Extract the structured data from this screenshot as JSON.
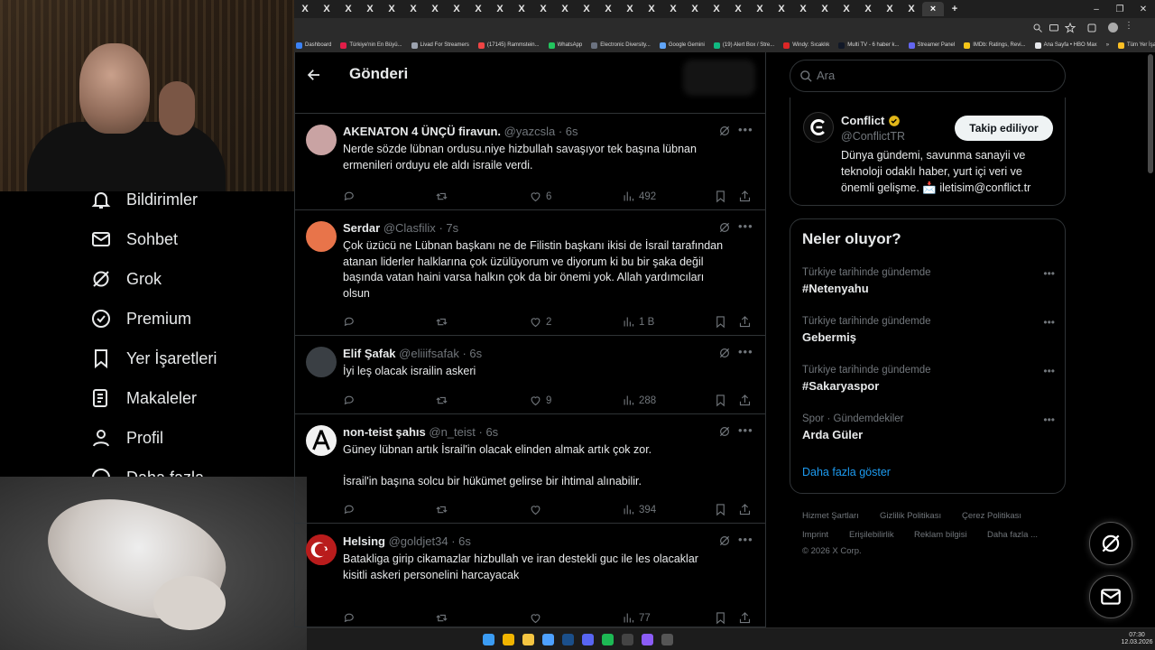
{
  "browser": {
    "tab_glyph": "X",
    "tab_count": 29,
    "active_close": "×",
    "new_tab": "+",
    "window": {
      "minimize": "–",
      "restore": "❐",
      "close": "✕"
    },
    "bookmarks": [
      {
        "label": "Dashboard",
        "color": "#3b82f6"
      },
      {
        "label": "Türkiye'nin En Büyü...",
        "color": "#e11d48"
      },
      {
        "label": "Livad For Streamers",
        "color": "#9ca3af"
      },
      {
        "label": "(17145) Rammstein...",
        "color": "#ef4444"
      },
      {
        "label": "WhatsApp",
        "color": "#22c55e"
      },
      {
        "label": "Electronic Diversity...",
        "color": "#6b7280"
      },
      {
        "label": "Google Gemini",
        "color": "#60a5fa"
      },
      {
        "label": "(19) Alert Box / Stre...",
        "color": "#10b981"
      },
      {
        "label": "Windy: Sıcaklık",
        "color": "#dc2626"
      },
      {
        "label": "Multi TV - 6 haber k...",
        "color": "#111827"
      },
      {
        "label": "Streamer Panel",
        "color": "#6366f1"
      },
      {
        "label": "IMDb: Ratings, Revi...",
        "color": "#f5c518"
      },
      {
        "label": "Ana Sayfa • HBO Max",
        "color": "#e5e7eb"
      },
      {
        "label": "»",
        "color": ""
      },
      {
        "label": "Tüm Yer İşaretleri",
        "color": "#fbbf24"
      }
    ]
  },
  "nav": {
    "items": [
      {
        "label": "Bildirimler",
        "icon": "bell-icon"
      },
      {
        "label": "Sohbet",
        "icon": "mail-icon"
      },
      {
        "label": "Grok",
        "icon": "grok-icon"
      },
      {
        "label": "Premium",
        "icon": "verified-icon"
      },
      {
        "label": "Yer İşaretleri",
        "icon": "bookmark-icon"
      },
      {
        "label": "Makaleler",
        "icon": "article-icon"
      },
      {
        "label": "Profil",
        "icon": "person-icon"
      },
      {
        "label": "Daha fazla",
        "icon": "more-circle-icon"
      }
    ]
  },
  "header": {
    "title": "Gönderi"
  },
  "posts": [
    {
      "name": "AKENATON 4 ÜNÇÜ firavun.",
      "handle": "@yazcsla",
      "time": "· 6s",
      "text": "Nerde sözde lübnan ordusu.niye hizbullah savaşıyor tek başına lübnan\nermenileri  orduyu ele aldı israile verdi.",
      "likes": "6",
      "views": "492",
      "avatar_color": "#c9a3a3"
    },
    {
      "name": "Serdar",
      "handle": "@Clasfilix",
      "time": "· 7s",
      "text": "Çok üzücü ne Lübnan başkanı ne de Filistin başkanı ikisi de İsrail tarafından\natanan liderler halklarına çok üzülüyorum ve diyorum ki bu bir şaka değil\nbaşında vatan haini varsa halkın çok da bir önemi yok. Allah yardımcıları\nolsun",
      "likes": "2",
      "views": "1 B",
      "avatar_color": "#e8744a"
    },
    {
      "name": "Elif Şafak",
      "handle": "@eliiifsafak",
      "time": "· 6s",
      "text": "İyi  leş olacak israilin askeri",
      "likes": "9",
      "views": "288",
      "avatar_color": "#3a3f44"
    },
    {
      "name": "non-teist şahıs",
      "handle": "@n_teist",
      "time": "· 6s",
      "text": "Güney lübnan artık İsrail'in olacak elinden almak artık çok zor.\n\nİsrail'in başına solcu bir hükümet gelirse bir ihtimal alınabilir.",
      "likes": "",
      "views": "394",
      "avatar_color": "#f2f2f2"
    },
    {
      "name": "Helsing",
      "handle": "@goldjet34",
      "time": "· 6s",
      "text": "Batakliga girip cikamazlar hizbullah ve iran destekli guc ile les olacaklar\nkisitli askeri personelini harcayacak",
      "likes": "",
      "views": "77",
      "avatar_color": "#b91c1c"
    }
  ],
  "search": {
    "placeholder": "Ara"
  },
  "profile_card": {
    "name": "Conflict",
    "handle": "@ConflictTR",
    "follow_label": "Takip ediliyor",
    "bio": "Dünya gündemi, savunma sanayii ve teknoloji odaklı haber, yurt içi veri ve önemli gelişme. 📩 iletisim@conflict.tr"
  },
  "trends": {
    "title": "Neler oluyor?",
    "items": [
      {
        "context": "Türkiye tarihinde gündemde",
        "name": "#Netenyahu"
      },
      {
        "context": "Türkiye tarihinde gündemde",
        "name": "Gebermiş"
      },
      {
        "context": "Türkiye tarihinde gündemde",
        "name": "#Sakaryaspor"
      },
      {
        "context": "Spor · Gündemdekiler",
        "name": "Arda Güler"
      }
    ],
    "show_more": "Daha fazla göster"
  },
  "footer": {
    "links": [
      "Hizmet Şartları",
      "Gizlilik Politikası",
      "Çerez Politikası",
      "Imprint",
      "Erişilebilirlik",
      "Reklam bilgisi",
      "Daha fazla ..."
    ],
    "copyright": "© 2026 X Corp."
  },
  "clock": {
    "time": "07:30",
    "date": "12.03.2026"
  },
  "colors": {
    "accent": "#1d9bf0",
    "muted": "#71767b",
    "border": "#2f3336",
    "verified_gold": "#e2b719"
  }
}
